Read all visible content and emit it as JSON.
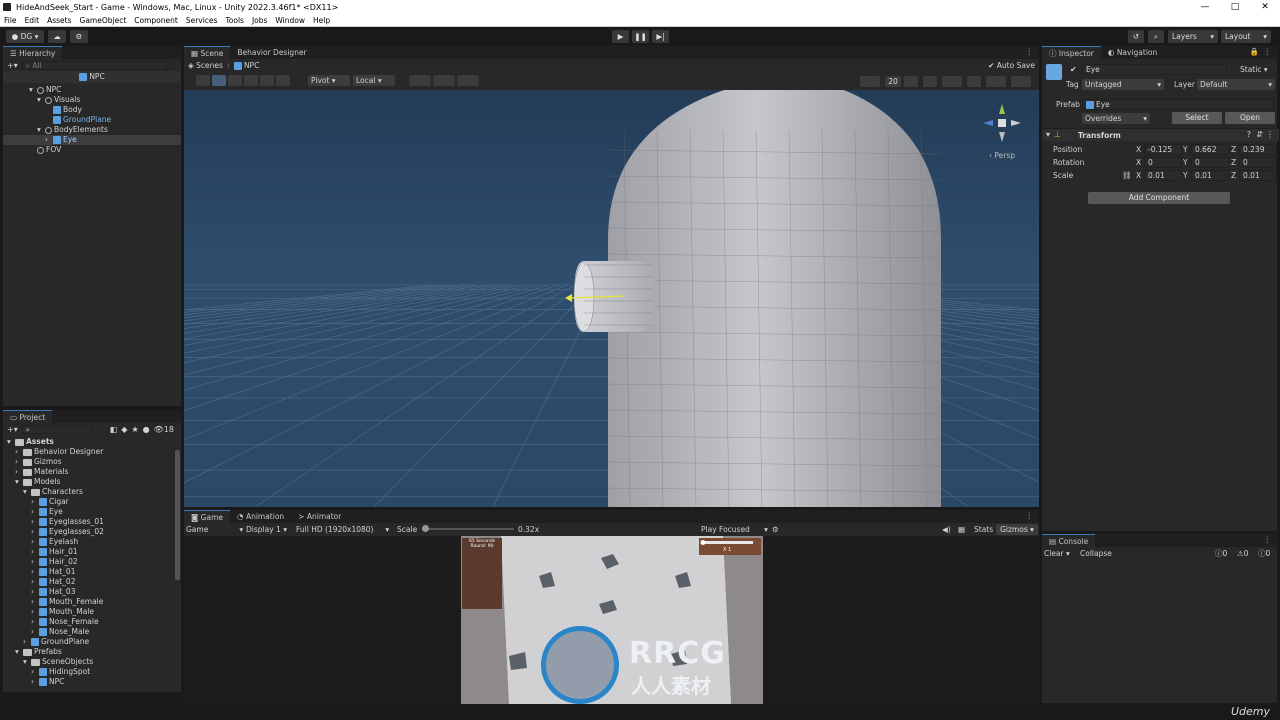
{
  "window": {
    "title": "HideAndSeek_Start - Game - Windows, Mac, Linux - Unity 2022.3.46f1* <DX11>"
  },
  "menu": [
    "File",
    "Edit",
    "Assets",
    "GameObject",
    "Component",
    "Services",
    "Tools",
    "Jobs",
    "Window",
    "Help"
  ],
  "toolbar": {
    "account": "DG",
    "layers": "Layers",
    "layout": "Layout"
  },
  "hierarchy": {
    "tab": "Hierarchy",
    "search_placeholder": "All",
    "header": "NPC",
    "items": [
      {
        "label": "NPC",
        "indent": 0
      },
      {
        "label": "Visuals",
        "indent": 1
      },
      {
        "label": "Body",
        "indent": 2
      },
      {
        "label": "GroundPlane",
        "indent": 2
      },
      {
        "label": "BodyElements",
        "indent": 1
      },
      {
        "label": "Eye",
        "indent": 2
      },
      {
        "label": "FOV",
        "indent": 0
      }
    ]
  },
  "scene": {
    "tabs": [
      "Scene",
      "Behavior Designer"
    ],
    "breadcrumb_root": "Scenes",
    "breadcrumb_item": "NPC",
    "auto_save": "Auto Save",
    "pivot": "Pivot",
    "local": "Local",
    "persp": "Persp",
    "gizmo_count": "20"
  },
  "game": {
    "tabs": [
      "Game",
      "Animation",
      "Animator"
    ],
    "mode": "Game",
    "display": "Display 1",
    "resolution": "Full HD (1920x1080)",
    "scale_label": "Scale",
    "scale_value": "0.32x",
    "play_focused": "Play Focused",
    "stats": "Stats",
    "gizmos": "Gizmos",
    "hud_line1": "65 Seconds",
    "hud_line2": "Round: 90",
    "hud_mult": "X 1",
    "watermark_brand": "RRCG",
    "watermark_sub": "人人素材"
  },
  "project": {
    "tab": "Project",
    "count": "18",
    "items": [
      {
        "label": "Assets",
        "indent": 0,
        "type": "folder"
      },
      {
        "label": "Behavior Designer",
        "indent": 1,
        "type": "folder"
      },
      {
        "label": "Gizmos",
        "indent": 1,
        "type": "folder"
      },
      {
        "label": "Materials",
        "indent": 1,
        "type": "folder"
      },
      {
        "label": "Models",
        "indent": 1,
        "type": "folder"
      },
      {
        "label": "Characters",
        "indent": 2,
        "type": "folder"
      },
      {
        "label": "Cigar",
        "indent": 3,
        "type": "prefab"
      },
      {
        "label": "Eye",
        "indent": 3,
        "type": "prefab"
      },
      {
        "label": "Eyeglasses_01",
        "indent": 3,
        "type": "prefab"
      },
      {
        "label": "Eyeglasses_02",
        "indent": 3,
        "type": "prefab"
      },
      {
        "label": "Eyelash",
        "indent": 3,
        "type": "prefab"
      },
      {
        "label": "Hair_01",
        "indent": 3,
        "type": "prefab"
      },
      {
        "label": "Hair_02",
        "indent": 3,
        "type": "prefab"
      },
      {
        "label": "Hat_01",
        "indent": 3,
        "type": "prefab"
      },
      {
        "label": "Hat_02",
        "indent": 3,
        "type": "prefab"
      },
      {
        "label": "Hat_03",
        "indent": 3,
        "type": "prefab"
      },
      {
        "label": "Mouth_Female",
        "indent": 3,
        "type": "prefab"
      },
      {
        "label": "Mouth_Male",
        "indent": 3,
        "type": "prefab"
      },
      {
        "label": "Nose_Female",
        "indent": 3,
        "type": "prefab"
      },
      {
        "label": "Nose_Male",
        "indent": 3,
        "type": "prefab"
      },
      {
        "label": "GroundPlane",
        "indent": 2,
        "type": "prefab"
      },
      {
        "label": "Prefabs",
        "indent": 1,
        "type": "folder"
      },
      {
        "label": "SceneObjects",
        "indent": 2,
        "type": "folder"
      },
      {
        "label": "HidingSpot",
        "indent": 3,
        "type": "prefab"
      },
      {
        "label": "NPC",
        "indent": 3,
        "type": "prefab"
      }
    ]
  },
  "inspector": {
    "tabs": [
      "Inspector",
      "Navigation"
    ],
    "object_name": "Eye",
    "static": "Static",
    "tag_label": "Tag",
    "tag_value": "Untagged",
    "layer_label": "Layer",
    "layer_value": "Default",
    "prefab_label": "Prefab",
    "prefab_value": "Eye",
    "overrides": "Overrides",
    "select": "Select",
    "open": "Open",
    "transform": "Transform",
    "position": {
      "label": "Position",
      "x": "-0.125",
      "y": "0.662",
      "z": "0.239"
    },
    "rotation": {
      "label": "Rotation",
      "x": "0",
      "y": "0",
      "z": "0"
    },
    "scale": {
      "label": "Scale",
      "x": "0.01",
      "y": "0.01",
      "z": "0.01"
    },
    "add_component": "Add Component"
  },
  "console": {
    "tab": "Console",
    "clear": "Clear",
    "collapse": "Collapse",
    "c0": "0",
    "c1": "0",
    "c2": "0"
  },
  "footer": {
    "brand": "Udemy"
  }
}
